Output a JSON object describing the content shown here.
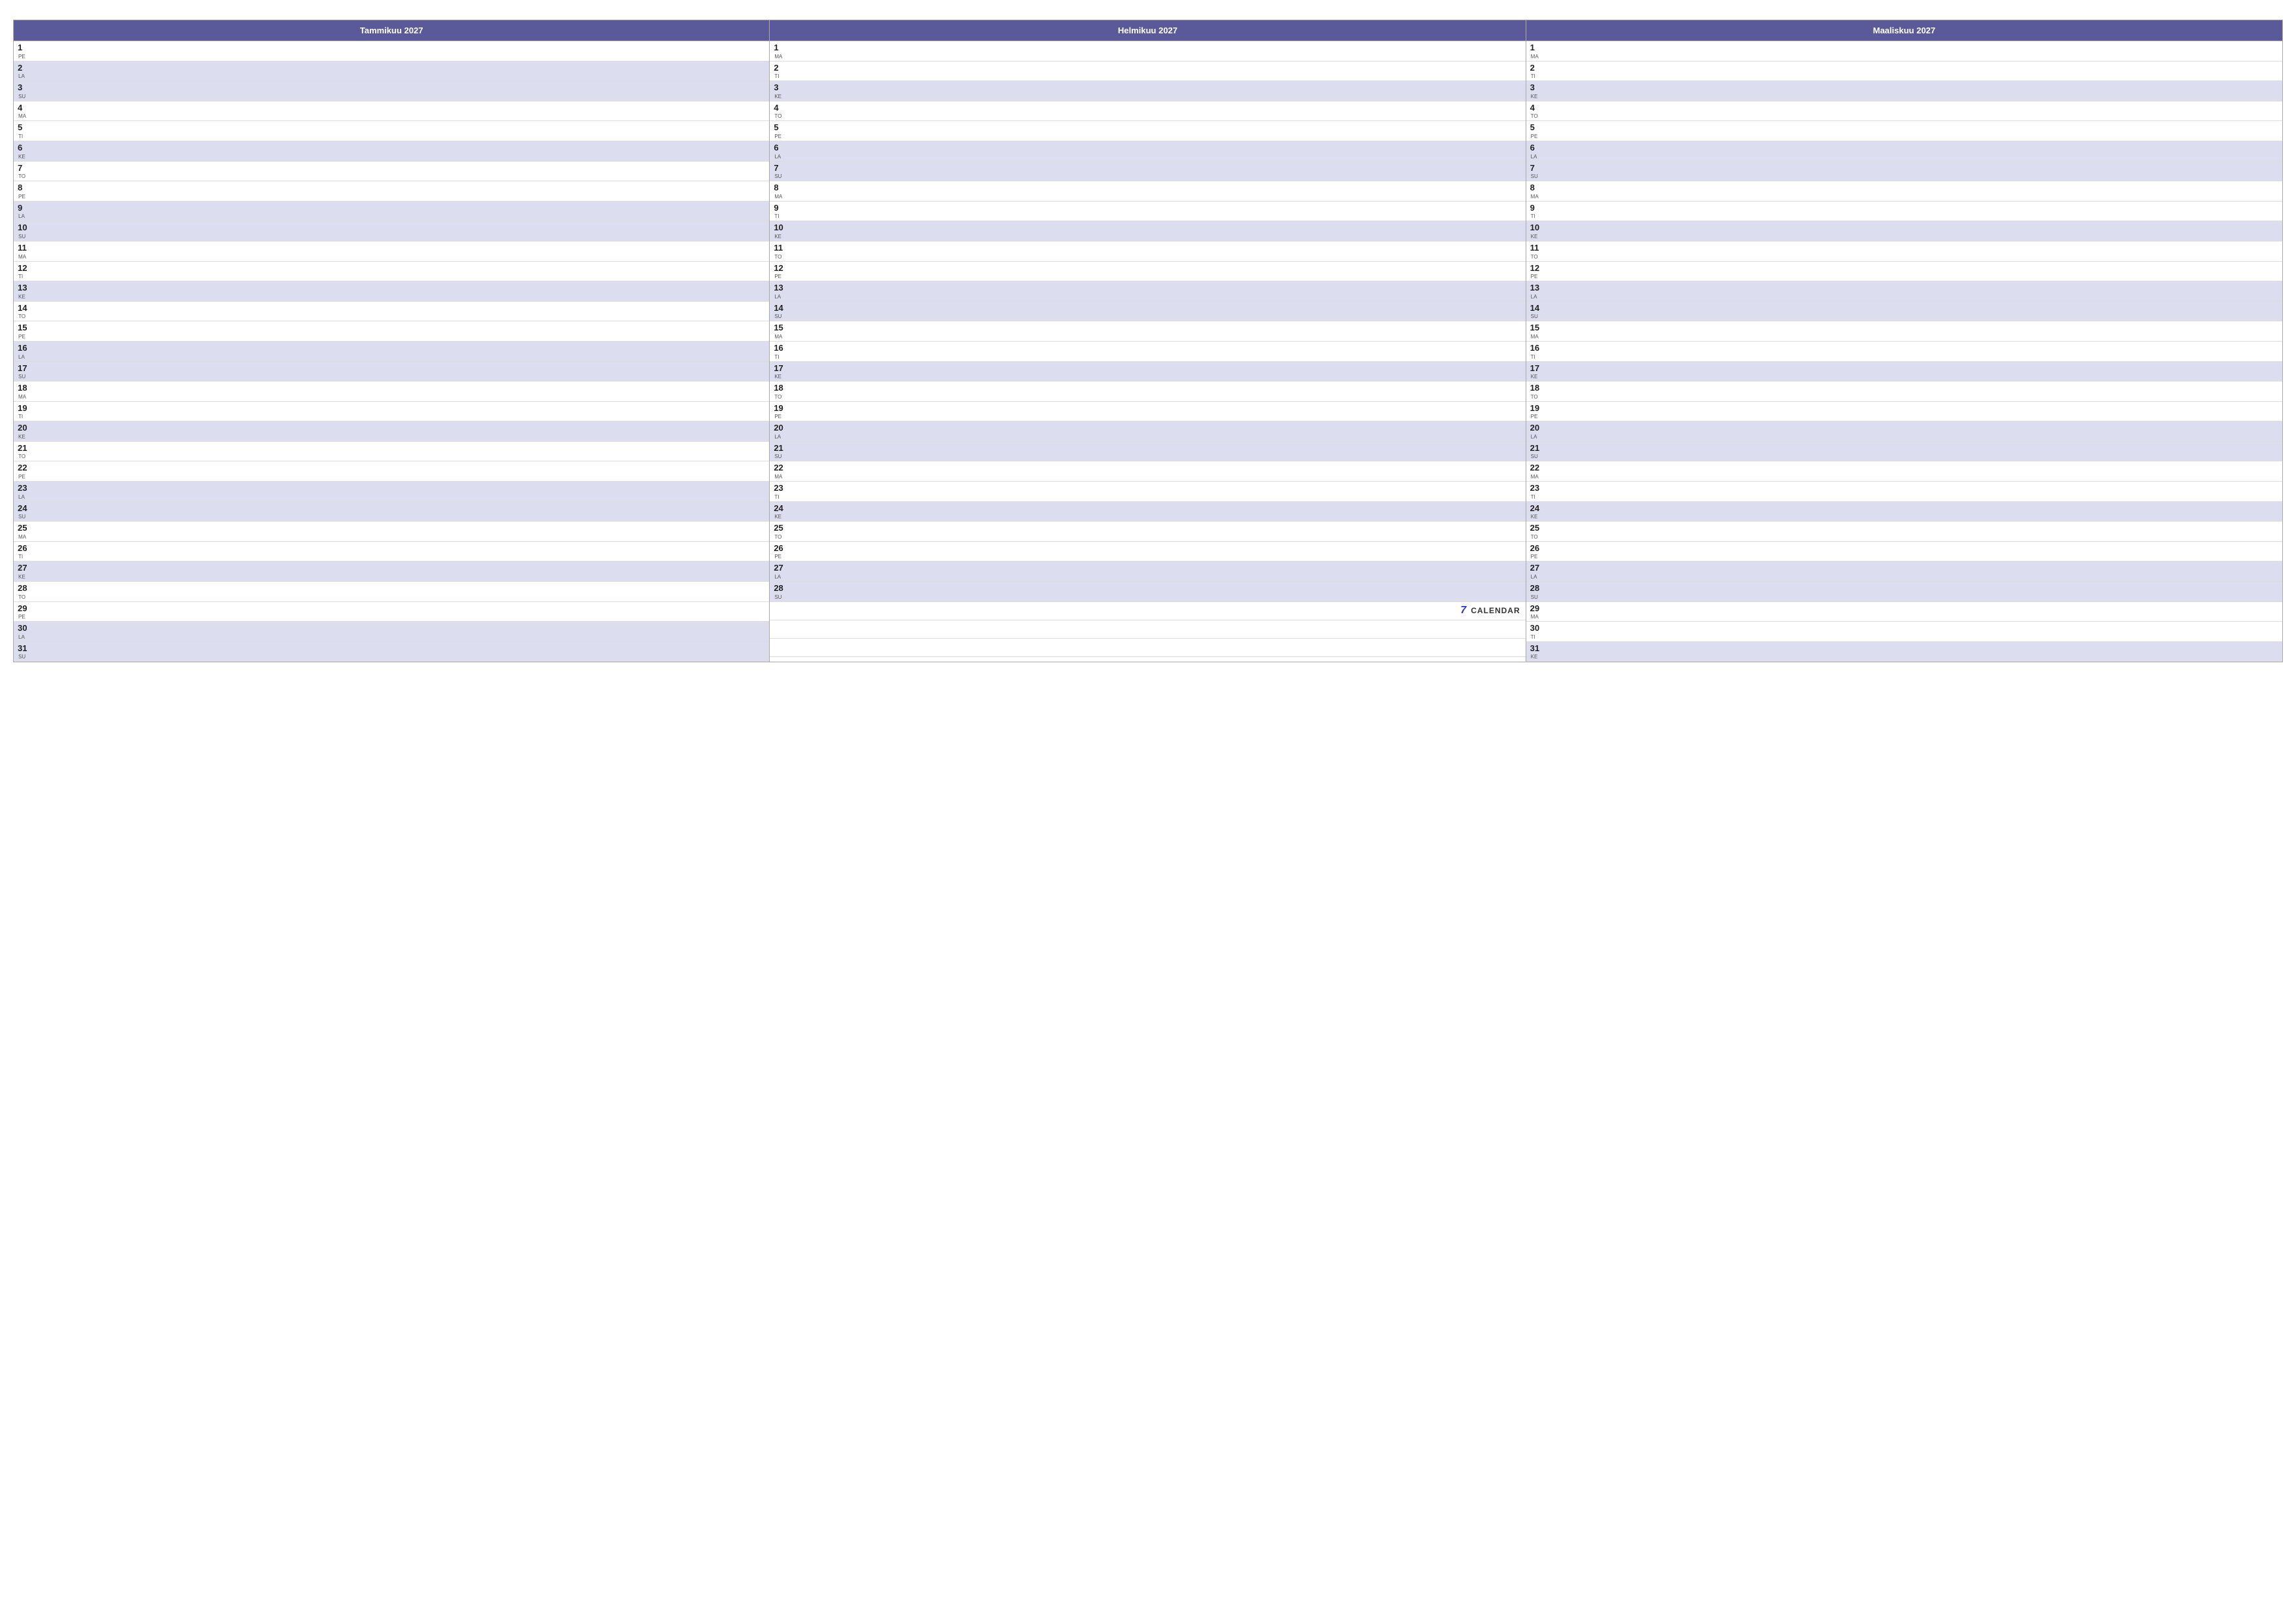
{
  "months": [
    {
      "name": "Tammikuu 2027",
      "days": [
        {
          "num": "1",
          "name": "PE",
          "weekend": false
        },
        {
          "num": "2",
          "name": "LA",
          "weekend": true
        },
        {
          "num": "3",
          "name": "SU",
          "weekend": true
        },
        {
          "num": "4",
          "name": "MA",
          "weekend": false
        },
        {
          "num": "5",
          "name": "TI",
          "weekend": false
        },
        {
          "num": "6",
          "name": "KE",
          "weekend": true
        },
        {
          "num": "7",
          "name": "TO",
          "weekend": false
        },
        {
          "num": "8",
          "name": "PE",
          "weekend": false
        },
        {
          "num": "9",
          "name": "LA",
          "weekend": true
        },
        {
          "num": "10",
          "name": "SU",
          "weekend": true
        },
        {
          "num": "11",
          "name": "MA",
          "weekend": false
        },
        {
          "num": "12",
          "name": "TI",
          "weekend": false
        },
        {
          "num": "13",
          "name": "KE",
          "weekend": true
        },
        {
          "num": "14",
          "name": "TO",
          "weekend": false
        },
        {
          "num": "15",
          "name": "PE",
          "weekend": false
        },
        {
          "num": "16",
          "name": "LA",
          "weekend": true
        },
        {
          "num": "17",
          "name": "SU",
          "weekend": true
        },
        {
          "num": "18",
          "name": "MA",
          "weekend": false
        },
        {
          "num": "19",
          "name": "TI",
          "weekend": false
        },
        {
          "num": "20",
          "name": "KE",
          "weekend": true
        },
        {
          "num": "21",
          "name": "TO",
          "weekend": false
        },
        {
          "num": "22",
          "name": "PE",
          "weekend": false
        },
        {
          "num": "23",
          "name": "LA",
          "weekend": true
        },
        {
          "num": "24",
          "name": "SU",
          "weekend": true
        },
        {
          "num": "25",
          "name": "MA",
          "weekend": false
        },
        {
          "num": "26",
          "name": "TI",
          "weekend": false
        },
        {
          "num": "27",
          "name": "KE",
          "weekend": true
        },
        {
          "num": "28",
          "name": "TO",
          "weekend": false
        },
        {
          "num": "29",
          "name": "PE",
          "weekend": false
        },
        {
          "num": "30",
          "name": "LA",
          "weekend": true
        },
        {
          "num": "31",
          "name": "SU",
          "weekend": true
        }
      ]
    },
    {
      "name": "Helmikuu 2027",
      "days": [
        {
          "num": "1",
          "name": "MA",
          "weekend": false
        },
        {
          "num": "2",
          "name": "TI",
          "weekend": false
        },
        {
          "num": "3",
          "name": "KE",
          "weekend": true
        },
        {
          "num": "4",
          "name": "TO",
          "weekend": false
        },
        {
          "num": "5",
          "name": "PE",
          "weekend": false
        },
        {
          "num": "6",
          "name": "LA",
          "weekend": true
        },
        {
          "num": "7",
          "name": "SU",
          "weekend": true
        },
        {
          "num": "8",
          "name": "MA",
          "weekend": false
        },
        {
          "num": "9",
          "name": "TI",
          "weekend": false
        },
        {
          "num": "10",
          "name": "KE",
          "weekend": true
        },
        {
          "num": "11",
          "name": "TO",
          "weekend": false
        },
        {
          "num": "12",
          "name": "PE",
          "weekend": false
        },
        {
          "num": "13",
          "name": "LA",
          "weekend": true
        },
        {
          "num": "14",
          "name": "SU",
          "weekend": true
        },
        {
          "num": "15",
          "name": "MA",
          "weekend": false
        },
        {
          "num": "16",
          "name": "TI",
          "weekend": false
        },
        {
          "num": "17",
          "name": "KE",
          "weekend": true
        },
        {
          "num": "18",
          "name": "TO",
          "weekend": false
        },
        {
          "num": "19",
          "name": "PE",
          "weekend": false
        },
        {
          "num": "20",
          "name": "LA",
          "weekend": true
        },
        {
          "num": "21",
          "name": "SU",
          "weekend": true
        },
        {
          "num": "22",
          "name": "MA",
          "weekend": false
        },
        {
          "num": "23",
          "name": "TI",
          "weekend": false
        },
        {
          "num": "24",
          "name": "KE",
          "weekend": true
        },
        {
          "num": "25",
          "name": "TO",
          "weekend": false
        },
        {
          "num": "26",
          "name": "PE",
          "weekend": false
        },
        {
          "num": "27",
          "name": "LA",
          "weekend": true
        },
        {
          "num": "28",
          "name": "SU",
          "weekend": true
        }
      ],
      "showLogo": true,
      "logoAfterDay": 28
    },
    {
      "name": "Maaliskuu 2027",
      "days": [
        {
          "num": "1",
          "name": "MA",
          "weekend": false
        },
        {
          "num": "2",
          "name": "TI",
          "weekend": false
        },
        {
          "num": "3",
          "name": "KE",
          "weekend": true
        },
        {
          "num": "4",
          "name": "TO",
          "weekend": false
        },
        {
          "num": "5",
          "name": "PE",
          "weekend": false
        },
        {
          "num": "6",
          "name": "LA",
          "weekend": true
        },
        {
          "num": "7",
          "name": "SU",
          "weekend": true
        },
        {
          "num": "8",
          "name": "MA",
          "weekend": false
        },
        {
          "num": "9",
          "name": "TI",
          "weekend": false
        },
        {
          "num": "10",
          "name": "KE",
          "weekend": true
        },
        {
          "num": "11",
          "name": "TO",
          "weekend": false
        },
        {
          "num": "12",
          "name": "PE",
          "weekend": false
        },
        {
          "num": "13",
          "name": "LA",
          "weekend": true
        },
        {
          "num": "14",
          "name": "SU",
          "weekend": true
        },
        {
          "num": "15",
          "name": "MA",
          "weekend": false
        },
        {
          "num": "16",
          "name": "TI",
          "weekend": false
        },
        {
          "num": "17",
          "name": "KE",
          "weekend": true
        },
        {
          "num": "18",
          "name": "TO",
          "weekend": false
        },
        {
          "num": "19",
          "name": "PE",
          "weekend": false
        },
        {
          "num": "20",
          "name": "LA",
          "weekend": true
        },
        {
          "num": "21",
          "name": "SU",
          "weekend": true
        },
        {
          "num": "22",
          "name": "MA",
          "weekend": false
        },
        {
          "num": "23",
          "name": "TI",
          "weekend": false
        },
        {
          "num": "24",
          "name": "KE",
          "weekend": true
        },
        {
          "num": "25",
          "name": "TO",
          "weekend": false
        },
        {
          "num": "26",
          "name": "PE",
          "weekend": false
        },
        {
          "num": "27",
          "name": "LA",
          "weekend": true
        },
        {
          "num": "28",
          "name": "SU",
          "weekend": true
        },
        {
          "num": "29",
          "name": "MA",
          "weekend": false
        },
        {
          "num": "30",
          "name": "TI",
          "weekend": false
        },
        {
          "num": "31",
          "name": "KE",
          "weekend": true
        }
      ]
    }
  ],
  "logo": {
    "icon": "7",
    "text": "CALENDAR"
  }
}
